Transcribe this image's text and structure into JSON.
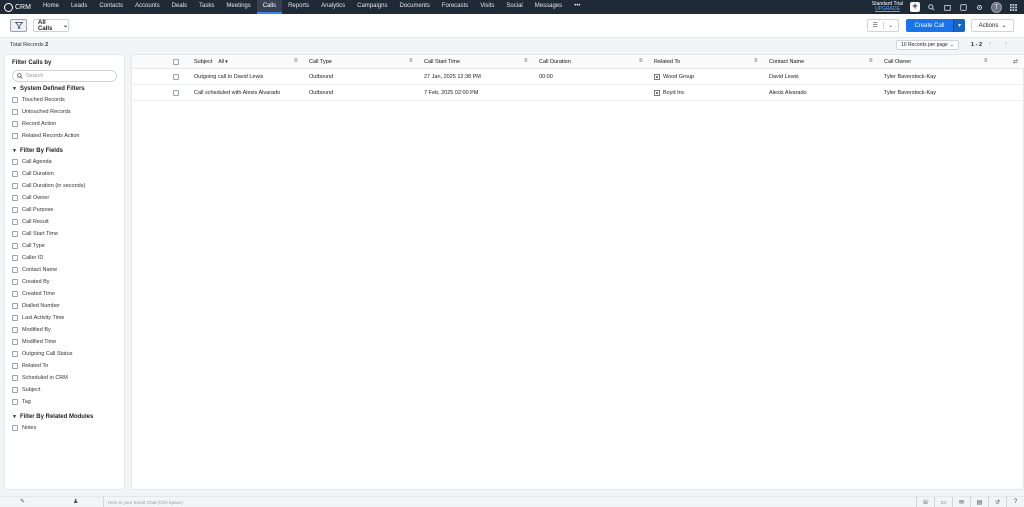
{
  "app": {
    "name": "CRM"
  },
  "nav": [
    {
      "label": "Home"
    },
    {
      "label": "Leads"
    },
    {
      "label": "Contacts"
    },
    {
      "label": "Accounts"
    },
    {
      "label": "Deals"
    },
    {
      "label": "Tasks"
    },
    {
      "label": "Meetings"
    },
    {
      "label": "Calls",
      "active": true
    },
    {
      "label": "Reports"
    },
    {
      "label": "Analytics"
    },
    {
      "label": "Campaigns"
    },
    {
      "label": "Documents"
    },
    {
      "label": "Forecasts"
    },
    {
      "label": "Visits"
    },
    {
      "label": "Social"
    },
    {
      "label": "Messages"
    },
    {
      "label": "•••"
    }
  ],
  "topright": {
    "trial": "Standard Trial",
    "upgrade": "UPGRADE",
    "avatar": "T"
  },
  "toolbar": {
    "view": "All Calls",
    "create": "Create Call",
    "actions": "Actions"
  },
  "subbar": {
    "total_label": "Total Records",
    "total_count": "2",
    "per_page": "10 Records per page",
    "page_info": "1 - 2"
  },
  "sidebar": {
    "title": "Filter Calls by",
    "search_placeholder": "Search",
    "system_title": "System Defined Filters",
    "system_items": [
      "Touched Records",
      "Untouched Records",
      "Record Action",
      "Related Records Action"
    ],
    "fields_title": "Filter By Fields",
    "field_items": [
      "Call Agenda",
      "Call Duration",
      "Call Duration (in seconds)",
      "Call Owner",
      "Call Purpose",
      "Call Result",
      "Call Start Time",
      "Call Type",
      "Caller ID",
      "Contact Name",
      "Created By",
      "Created Time",
      "Dialled Number",
      "Last Activity Time",
      "Modified By",
      "Modified Time",
      "Outgoing Call Status",
      "Related To",
      "Scheduled in CRM",
      "Subject",
      "Tag"
    ],
    "related_title": "Filter By Related Modules",
    "related_items": [
      "Notes"
    ]
  },
  "table": {
    "headers": {
      "subject": "Subject",
      "subject_filter": "All",
      "call_type": "Call Type",
      "start_time": "Call Start Time",
      "duration": "Call Duration",
      "related_to": "Related To",
      "contact": "Contact Name",
      "owner": "Call Owner"
    },
    "rows": [
      {
        "subject": "Outgoing call to David Lewis",
        "call_type": "Outbound",
        "start_time": "27 Jan, 2025 12:38 PM",
        "duration": "00:00",
        "related_to": "Wood Group",
        "contact": "David Lewis",
        "owner": "Tyler Baverstock-Kay"
      },
      {
        "subject": "Call scheduled with Alexis Alvarado",
        "call_type": "Outbound",
        "start_time": "7 Feb, 2025 02:00 PM",
        "duration": "",
        "related_to": "Boyd Inc",
        "contact": "Alexis Alvarado",
        "owner": "Tyler Baverstock-Kay"
      }
    ]
  },
  "footer": {
    "smart_chat": "Here is your Smart Chat (Ctrl+Space)"
  }
}
